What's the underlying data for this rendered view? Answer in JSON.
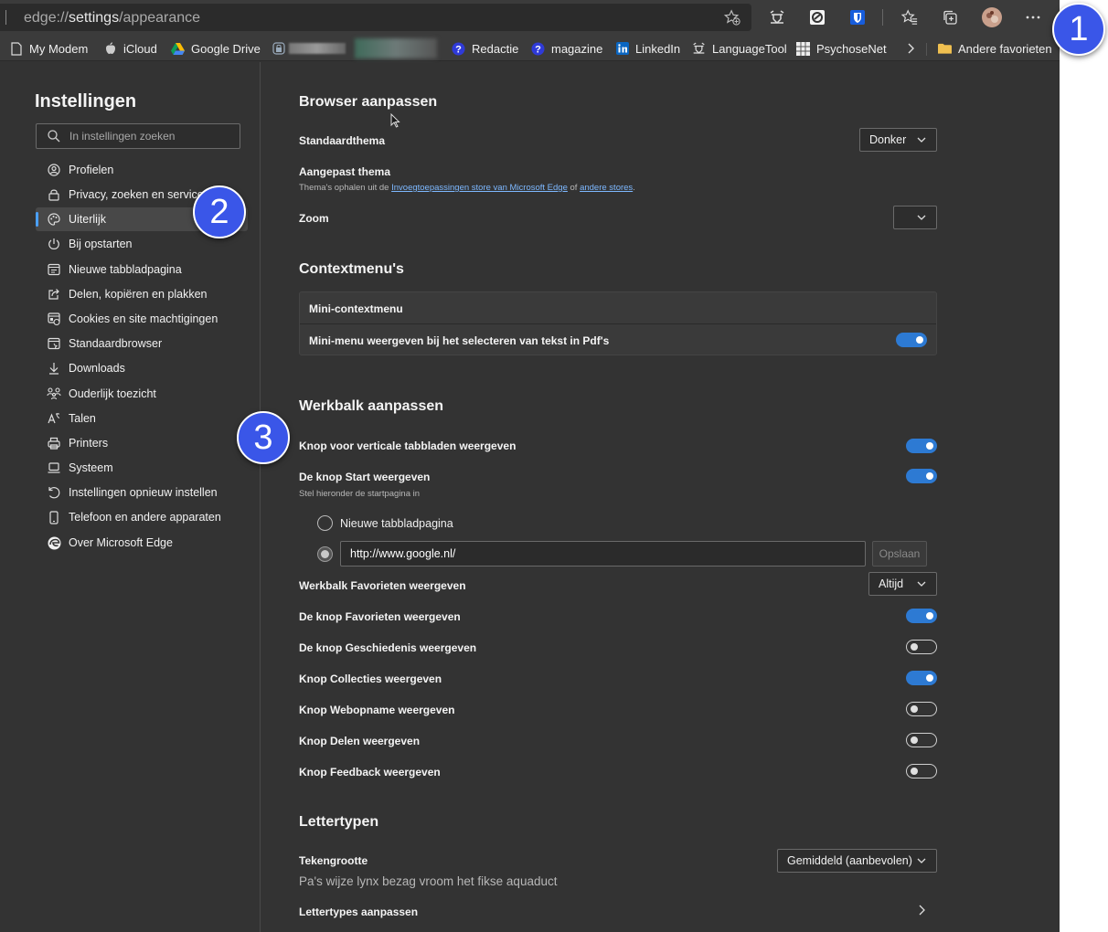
{
  "address_bar": {
    "url_prefix": "edge://",
    "url_host": "settings",
    "url_path": "/appearance"
  },
  "bookmarks": [
    {
      "label": "My Modem",
      "icon": "page-icon"
    },
    {
      "label": "iCloud",
      "icon": "apple-icon"
    },
    {
      "label": "Google Drive",
      "icon": "google-drive-icon"
    },
    {
      "label": "Redactie",
      "icon": "help-icon"
    },
    {
      "label": "magazine",
      "icon": "help-icon"
    },
    {
      "label": "LinkedIn",
      "icon": "linkedin-icon"
    },
    {
      "label": "LanguageTool",
      "icon": "languagetool-icon"
    },
    {
      "label": "PsychoseNet",
      "icon": "grid-icon"
    },
    {
      "label": "Andere favorieten",
      "icon": "folder-icon"
    }
  ],
  "sidebar": {
    "title": "Instellingen",
    "search_placeholder": "In instellingen zoeken",
    "items": [
      {
        "label": "Profielen",
        "icon": "profile-icon"
      },
      {
        "label": "Privacy, zoeken en services",
        "icon": "lock-icon"
      },
      {
        "label": "Uiterlijk",
        "icon": "palette-icon",
        "active": true
      },
      {
        "label": "Bij opstarten",
        "icon": "power-icon"
      },
      {
        "label": "Nieuwe tabbladpagina",
        "icon": "newtab-icon"
      },
      {
        "label": "Delen, kopiëren en plakken",
        "icon": "share-icon"
      },
      {
        "label": "Cookies en site machtigingen",
        "icon": "cookies-icon"
      },
      {
        "label": "Standaardbrowser",
        "icon": "browser-icon"
      },
      {
        "label": "Downloads",
        "icon": "download-icon"
      },
      {
        "label": "Ouderlijk toezicht",
        "icon": "family-icon"
      },
      {
        "label": "Talen",
        "icon": "language-icon"
      },
      {
        "label": "Printers",
        "icon": "printer-icon"
      },
      {
        "label": "Systeem",
        "icon": "laptop-icon"
      },
      {
        "label": "Instellingen opnieuw instellen",
        "icon": "reset-icon"
      },
      {
        "label": "Telefoon en andere apparaten",
        "icon": "phone-icon"
      },
      {
        "label": "Over Microsoft Edge",
        "icon": "edge-icon"
      }
    ]
  },
  "main": {
    "browser_section": {
      "title": "Browser aanpassen",
      "theme_label": "Standaardthema",
      "theme_value": "Donker",
      "custom_theme_label": "Aangepast thema",
      "custom_theme_desc_prefix": "Thema's ophalen uit de ",
      "custom_theme_link1": "Invoegtoepassingen store van Microsoft Edge",
      "custom_theme_desc_mid": " of ",
      "custom_theme_link2": "andere stores",
      "custom_theme_desc_suffix": ".",
      "zoom_label": "Zoom",
      "zoom_value": ""
    },
    "context_section": {
      "title": "Contextmenu's",
      "mini_label": "Mini-contextmenu",
      "mini_pdf_label": "Mini-menu weergeven bij het selecteren van tekst in Pdf's",
      "mini_pdf_on": true
    },
    "toolbar_section": {
      "title": "Werkbalk aanpassen",
      "vertical_tabs_label": "Knop voor verticale tabbladen weergeven",
      "start_label": "De knop Start weergeven",
      "start_desc": "Stel hieronder de startpagina in",
      "radio_newtab_label": "Nieuwe tabbladpagina",
      "url_value": "http://www.google.nl/",
      "save_label": "Opslaan",
      "fav_bar_label": "Werkbalk Favorieten weergeven",
      "fav_bar_value": "Altijd",
      "fav_button_label": "De knop Favorieten weergeven",
      "history_label": "De knop Geschiedenis weergeven",
      "collections_label": "Knop Collecties weergeven",
      "webcapture_label": "Knop Webopname weergeven",
      "share_label": "Knop Delen weergeven",
      "feedback_label": "Knop Feedback weergeven",
      "toggles": {
        "vertical_tabs": true,
        "start": true,
        "favorites": true,
        "history": false,
        "collections": true,
        "webcapture": false,
        "share": false,
        "feedback": false
      }
    },
    "fonts_section": {
      "title": "Lettertypen",
      "size_label": "Tekengrootte",
      "size_value": "Gemiddeld (aanbevolen)",
      "sample_text": "Pa's wijze lynx bezag vroom het fikse aquaduct",
      "customize_label": "Lettertypes aanpassen"
    }
  },
  "annotations": {
    "badge1": "1",
    "badge2": "2",
    "badge3": "3"
  },
  "colors": {
    "accent": "#2d7ad3",
    "badge": "#3a56e8",
    "background": "#333333"
  }
}
